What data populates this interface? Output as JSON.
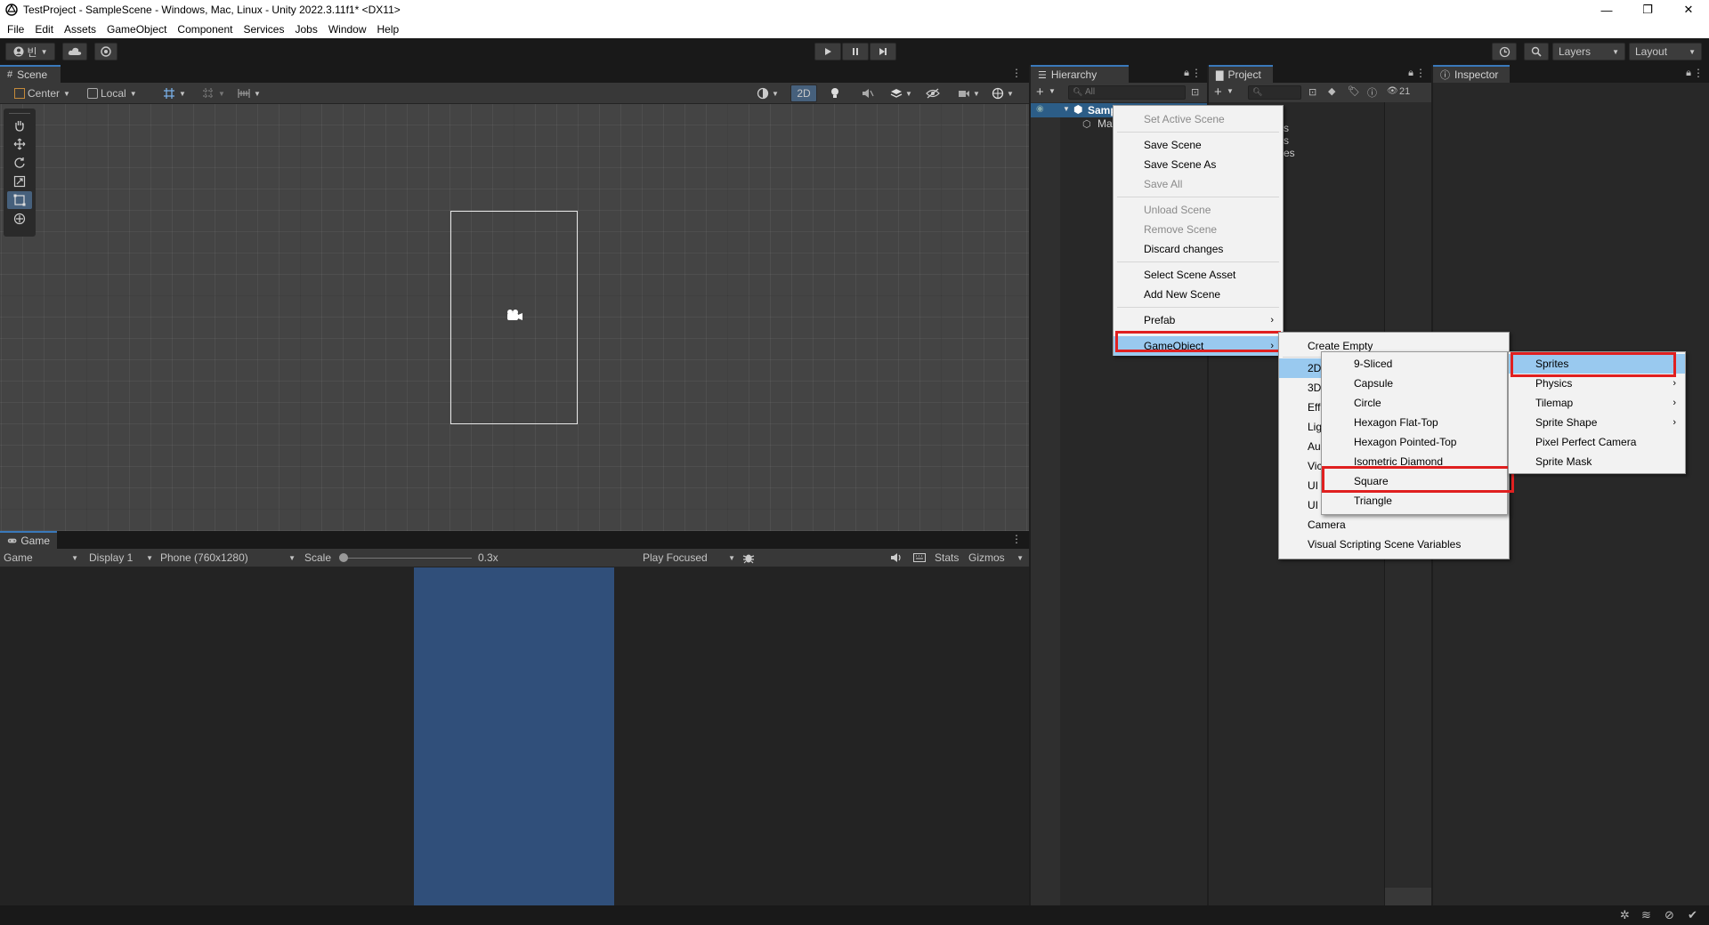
{
  "window": {
    "title": "TestProject - SampleScene - Windows, Mac, Linux - Unity 2022.3.11f1* <DX11>",
    "minimize": "—",
    "maximize": "❐",
    "close": "✕"
  },
  "menubar": [
    "File",
    "Edit",
    "Assets",
    "GameObject",
    "Component",
    "Services",
    "Jobs",
    "Window",
    "Help"
  ],
  "toolbar": {
    "account_glyph": "빈",
    "layers_label": "Layers",
    "layout_label": "Layout"
  },
  "scene": {
    "tab_label": "Scene",
    "pivot_label": "Center",
    "space_label": "Local",
    "mode_2d": "2D"
  },
  "game": {
    "tab_label": "Game",
    "mode_label": "Game",
    "display_label": "Display 1",
    "resolution_label": "Phone (760x1280)",
    "scale_label": "Scale",
    "scale_value": "0.3x",
    "play_mode_label": "Play Focused",
    "stats_label": "Stats",
    "gizmos_label": "Gizmos"
  },
  "hierarchy": {
    "tab_label": "Hierarchy",
    "search_placeholder": "All",
    "scene_item": "Samp",
    "child_item": "Ma"
  },
  "project": {
    "tab_label": "Project",
    "hidden_count": "21",
    "partial_rows": [
      "s",
      "s",
      "es"
    ]
  },
  "inspector": {
    "tab_label": "Inspector"
  },
  "context_menu": {
    "items": [
      {
        "label": "Set Active Scene",
        "disabled": true
      },
      {
        "sep": true
      },
      {
        "label": "Save Scene"
      },
      {
        "label": "Save Scene As"
      },
      {
        "label": "Save All",
        "disabled": true
      },
      {
        "sep": true
      },
      {
        "label": "Unload Scene",
        "disabled": true
      },
      {
        "label": "Remove Scene",
        "disabled": true
      },
      {
        "label": "Discard changes"
      },
      {
        "sep": true
      },
      {
        "label": "Select Scene Asset"
      },
      {
        "label": "Add New Scene"
      },
      {
        "sep": true
      },
      {
        "label": "Prefab",
        "arrow": true
      },
      {
        "sep": true
      },
      {
        "label": "GameObject",
        "arrow": true,
        "selected": true
      }
    ]
  },
  "gameobject_menu": {
    "items": [
      {
        "label": "Create Empty"
      },
      {
        "sep": true
      },
      {
        "label": "2D",
        "selected": true
      },
      {
        "label": "3D"
      },
      {
        "label": "Eff"
      },
      {
        "label": "Lig"
      },
      {
        "label": "Au"
      },
      {
        "label": "Vic"
      },
      {
        "label": "UI"
      },
      {
        "label": "UI"
      },
      {
        "label": "Camera"
      },
      {
        "label": "Visual Scripting Scene Variables"
      }
    ]
  },
  "sprites_menu": {
    "items": [
      {
        "label": "9-Sliced"
      },
      {
        "label": "Capsule"
      },
      {
        "label": "Circle"
      },
      {
        "label": "Hexagon Flat-Top"
      },
      {
        "label": "Hexagon Pointed-Top"
      },
      {
        "label": "Isometric Diamond"
      },
      {
        "label": "Square",
        "highlighted": true
      },
      {
        "label": "Triangle"
      }
    ]
  },
  "twod_menu": {
    "items": [
      {
        "label": "Sprites",
        "arrow": true,
        "selected": true
      },
      {
        "label": "Physics",
        "arrow": true
      },
      {
        "label": "Tilemap",
        "arrow": true
      },
      {
        "label": "Sprite Shape",
        "arrow": true
      },
      {
        "label": "Pixel Perfect Camera"
      },
      {
        "label": "Sprite Mask"
      }
    ]
  },
  "colors": {
    "accent": "#3a79bb",
    "menu_selected": "#99c9ef",
    "highlight_box": "#e02020",
    "game_canvas": "#304f7a"
  }
}
